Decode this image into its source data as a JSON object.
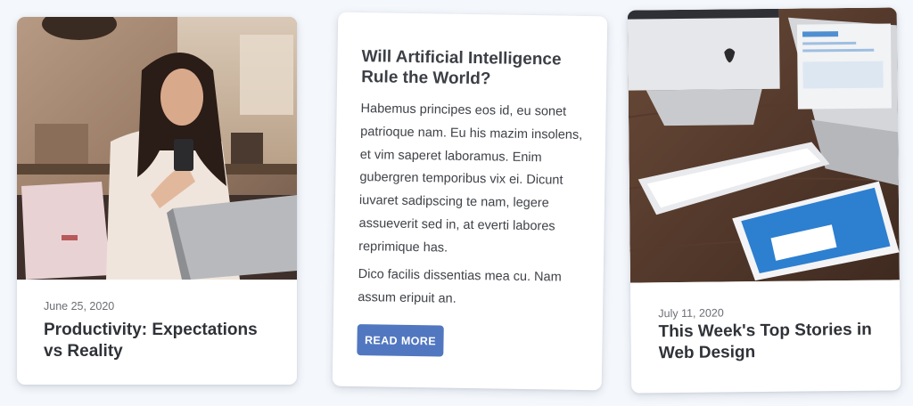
{
  "cards": [
    {
      "date": "June 25, 2020",
      "title": "Productivity: Expectations vs Reality"
    },
    {
      "title": "Will Artificial Intelligence Rule the World?",
      "paragraphs": [
        "Habemus principes eos id, eu sonet patrioque nam. Eu his mazim insolens, et vim saperet laboramus. Enim gubergren temporibus vix ei. Dicunt iuvaret sadipscing te nam, legere assueverit sed in, at everti labores reprimique has.",
        "Dico facilis dissentias mea cu. Nam assum eripuit an."
      ],
      "button_label": "READ MORE"
    },
    {
      "date": "July 11, 2020",
      "title": "This Week's Top Stories in Web Design"
    }
  ],
  "colors": {
    "page_background": "#f4f7fb",
    "card_background": "#ffffff",
    "button_background": "#5177c0",
    "title_text": "#2f3237",
    "date_text": "#6b6e74"
  }
}
